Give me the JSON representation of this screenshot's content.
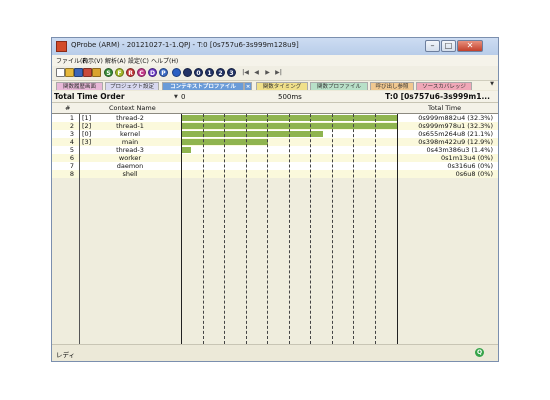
{
  "window": {
    "title": "QProbe (ARM) - 20121027-1-1.QPJ - T:0 [0s757u6-3s999m128u9]",
    "colors": {
      "titlebar": "#c4d5ed",
      "bar": "#8fb44f",
      "row_even": "#fbf9dc"
    }
  },
  "menu": [
    "ファイル(F)",
    "表示(V)",
    "解析(A)",
    "設定(C)",
    "ヘルプ(H)"
  ],
  "toolbar": {
    "buttons": [
      {
        "icon": "new-doc-icon",
        "color": "#ffffff"
      },
      {
        "icon": "open-folder-icon",
        "color": "#e6b83c"
      },
      {
        "icon": "save-icon",
        "color": "#3b64b8"
      },
      {
        "icon": "chart-icon",
        "color": "#c94a3a"
      },
      {
        "icon": "lock-icon",
        "color": "#d9a42e"
      },
      {
        "icon": "S",
        "color": "#3a8d3a"
      },
      {
        "icon": "F",
        "color": "#a3b82a"
      },
      {
        "icon": "R",
        "color": "#c4393a"
      },
      {
        "icon": "C",
        "color": "#c43a8a"
      },
      {
        "icon": "D",
        "color": "#6a3ac4"
      },
      {
        "icon": "P",
        "color": "#3a6ac4"
      },
      {
        "icon": "record-icon",
        "color": "#2a5fc4"
      },
      {
        "icon": "stop-icon",
        "color": "#223366"
      },
      {
        "icon": "0",
        "color": "#223366"
      },
      {
        "icon": "1",
        "color": "#223366"
      },
      {
        "icon": "2",
        "color": "#223366"
      },
      {
        "icon": "3",
        "color": "#223366"
      },
      {
        "icon": "first-icon",
        "color": "#555555"
      },
      {
        "icon": "prev-icon",
        "color": "#555555"
      },
      {
        "icon": "next-icon",
        "color": "#555555"
      },
      {
        "icon": "last-icon",
        "color": "#555555"
      }
    ]
  },
  "tabs": [
    {
      "label": "関数履歴画面",
      "color": "#e8b8d8",
      "active": false
    },
    {
      "label": "プロジェクト設定",
      "color": "#d8d8f0",
      "active": false
    },
    {
      "label": "コンテキストプロファイル",
      "color": "#6a9bd8",
      "active": true
    },
    {
      "label": "×",
      "color": "#6a9bd8",
      "active": true
    },
    {
      "label": "関数タイミング",
      "color": "#f0e08a",
      "active": false
    },
    {
      "label": "関数プロファイル",
      "color": "#b8e0c8",
      "active": false
    },
    {
      "label": "呼び出し参照",
      "color": "#f0c890",
      "active": false
    },
    {
      "label": "ソースカバレッジ",
      "color": "#f0a8b8",
      "active": false
    }
  ],
  "header": {
    "order": "Total Time Order",
    "scale_start": "0",
    "scale_mid": "500ms",
    "total_time": "T:0 [0s757u6-3s999m1..."
  },
  "columns": {
    "num": "#",
    "context": "Context Name",
    "total": "Total Time"
  },
  "rows": [
    {
      "num": "1",
      "idx": "[1]",
      "name": "thread-2",
      "total": "0s999m882u4 (32.3%)",
      "fraction": 1.0
    },
    {
      "num": "2",
      "idx": "[2]",
      "name": "thread-1",
      "total": "0s999m978u1 (32.3%)",
      "fraction": 1.0
    },
    {
      "num": "3",
      "idx": "[0]",
      "name": "kernel",
      "total": "0s655m264u8 (21.1%)",
      "fraction": 0.655
    },
    {
      "num": "4",
      "idx": "[3]",
      "name": "main",
      "total": "0s398m422u9 (12.9%)",
      "fraction": 0.398
    },
    {
      "num": "5",
      "idx": "",
      "name": "thread-3",
      "total": "0s43m386u3 (1.4%)",
      "fraction": 0.043
    },
    {
      "num": "6",
      "idx": "",
      "name": "worker",
      "total": "0s1m13u4 (0%)",
      "fraction": 0.0
    },
    {
      "num": "7",
      "idx": "",
      "name": "daemon",
      "total": "0s316u6 (0%)",
      "fraction": 0.0
    },
    {
      "num": "8",
      "idx": "",
      "name": "shell",
      "total": "0s6u8 (0%)",
      "fraction": 0.0
    }
  ],
  "status": {
    "text": "レディ",
    "indicator": "Q"
  }
}
